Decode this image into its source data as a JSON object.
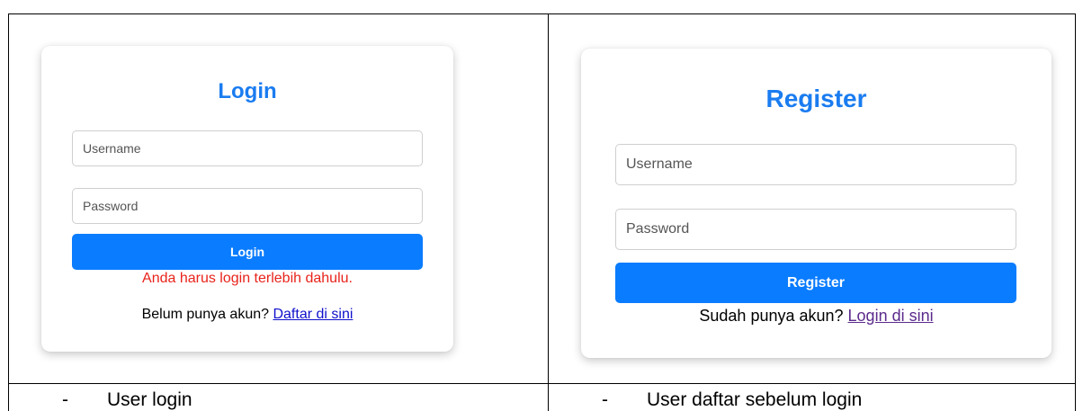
{
  "login": {
    "title": "Login",
    "username_placeholder": "Username",
    "password_placeholder": "Password",
    "button_label": "Login",
    "error_message": "Anda harus login terlebih dahulu.",
    "prompt_text": "Belum punya akun? ",
    "link_text": "Daftar di sini",
    "link_color": "#1010cc"
  },
  "register": {
    "title": "Register",
    "username_placeholder": "Username",
    "password_placeholder": "Password",
    "button_label": "Register",
    "prompt_text": "Sudah punya akun? ",
    "link_text": "Login di sini",
    "link_color": "#5b2a8c"
  },
  "captions": {
    "left_bullet": "-",
    "left_text": "User login",
    "right_bullet": "-",
    "right_text": "User daftar sebelum login"
  },
  "colors": {
    "accent": "#0a7cff",
    "title": "#1a7cf0",
    "error": "#e8231b"
  }
}
